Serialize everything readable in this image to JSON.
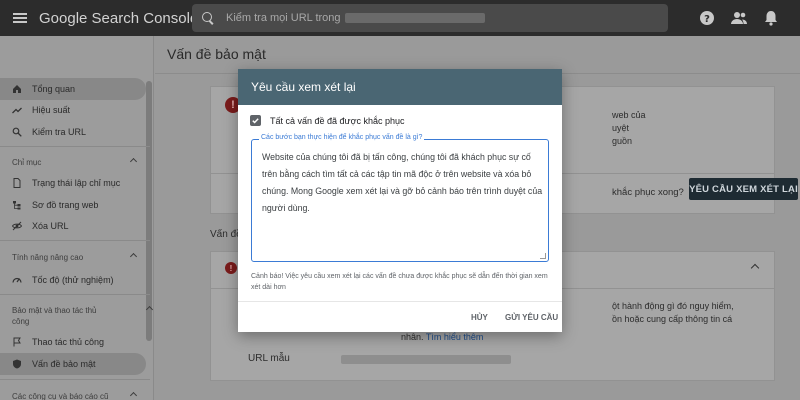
{
  "topbar": {
    "app_name": "Google Search Console",
    "search_placeholder": "Kiểm tra mọi URL trong"
  },
  "sidebar": {
    "items_top": [
      {
        "label": "Tổng quan",
        "icon": "home-icon"
      },
      {
        "label": "Hiệu suất",
        "icon": "trending-up-icon"
      },
      {
        "label": "Kiểm tra URL",
        "icon": "search-icon"
      }
    ],
    "section_index": "Chỉ mục",
    "items_index": [
      {
        "label": "Trạng thái lập chỉ mục",
        "icon": "file-icon"
      },
      {
        "label": "Sơ đồ trang web",
        "icon": "sitemap-icon"
      },
      {
        "label": "Xóa URL",
        "icon": "eye-off-icon"
      }
    ],
    "section_enhancements": "Tính năng nâng cao",
    "items_enhancements": [
      {
        "label": "Tốc độ (thử nghiệm)",
        "icon": "speed-icon"
      }
    ],
    "section_security": "Bảo mật và thao tác thủ công",
    "items_security": [
      {
        "label": "Thao tác thủ công",
        "icon": "flag-icon"
      },
      {
        "label": "Vấn đề bảo mật",
        "icon": "shield-icon"
      }
    ],
    "section_legacy": "Các công cụ và báo cáo cũ"
  },
  "main": {
    "title": "Vấn đề bảo mật",
    "card1_text": [
      "web của",
      "uyệt",
      "guồn"
    ],
    "card1_question": "khắc phục xong?",
    "request_review_button": "YÊU CẦU XEM XÉT LẠI",
    "section2_label": "Vấn đề",
    "card2_text": [
      "ột hành động gì đó nguy hiểm,",
      "ồn hoặc cung cấp thông tin cá"
    ],
    "card2_prefix": "nhân.",
    "card2_link": "Tìm hiểu thêm",
    "url_label": "URL mẫu"
  },
  "dialog": {
    "title": "Yêu cầu xem xét lại",
    "checkbox_label": "Tất cả vấn đề đã được khắc phục",
    "textarea_label": "Các bước bạn thực hiện để khắc phục vấn đề là gì?",
    "textarea_value": "Website của chúng tôi đã bị tấn công, chúng tôi đã khách phục sự cố trên bằng cách tìm tất cả các tập tin mã độc ở trên website và xóa bỏ chúng. Mong Google xem xét lại và gỡ bỏ cảnh báo trên trình duyệt của người dùng.",
    "warning": "Cảnh báo! Việc yêu cầu xem xét lại các vấn đề chưa được khắc phục sẽ dẫn đến thời gian xem xét dài hơn",
    "cancel_label": "HỦY",
    "submit_label": "GỬI YÊU CẦU"
  },
  "colors": {
    "dialog_header": "#4a6673",
    "focus_blue": "#3b7bd5",
    "alert_red": "#7a1b1b",
    "topbar": "#2c2c2c"
  }
}
